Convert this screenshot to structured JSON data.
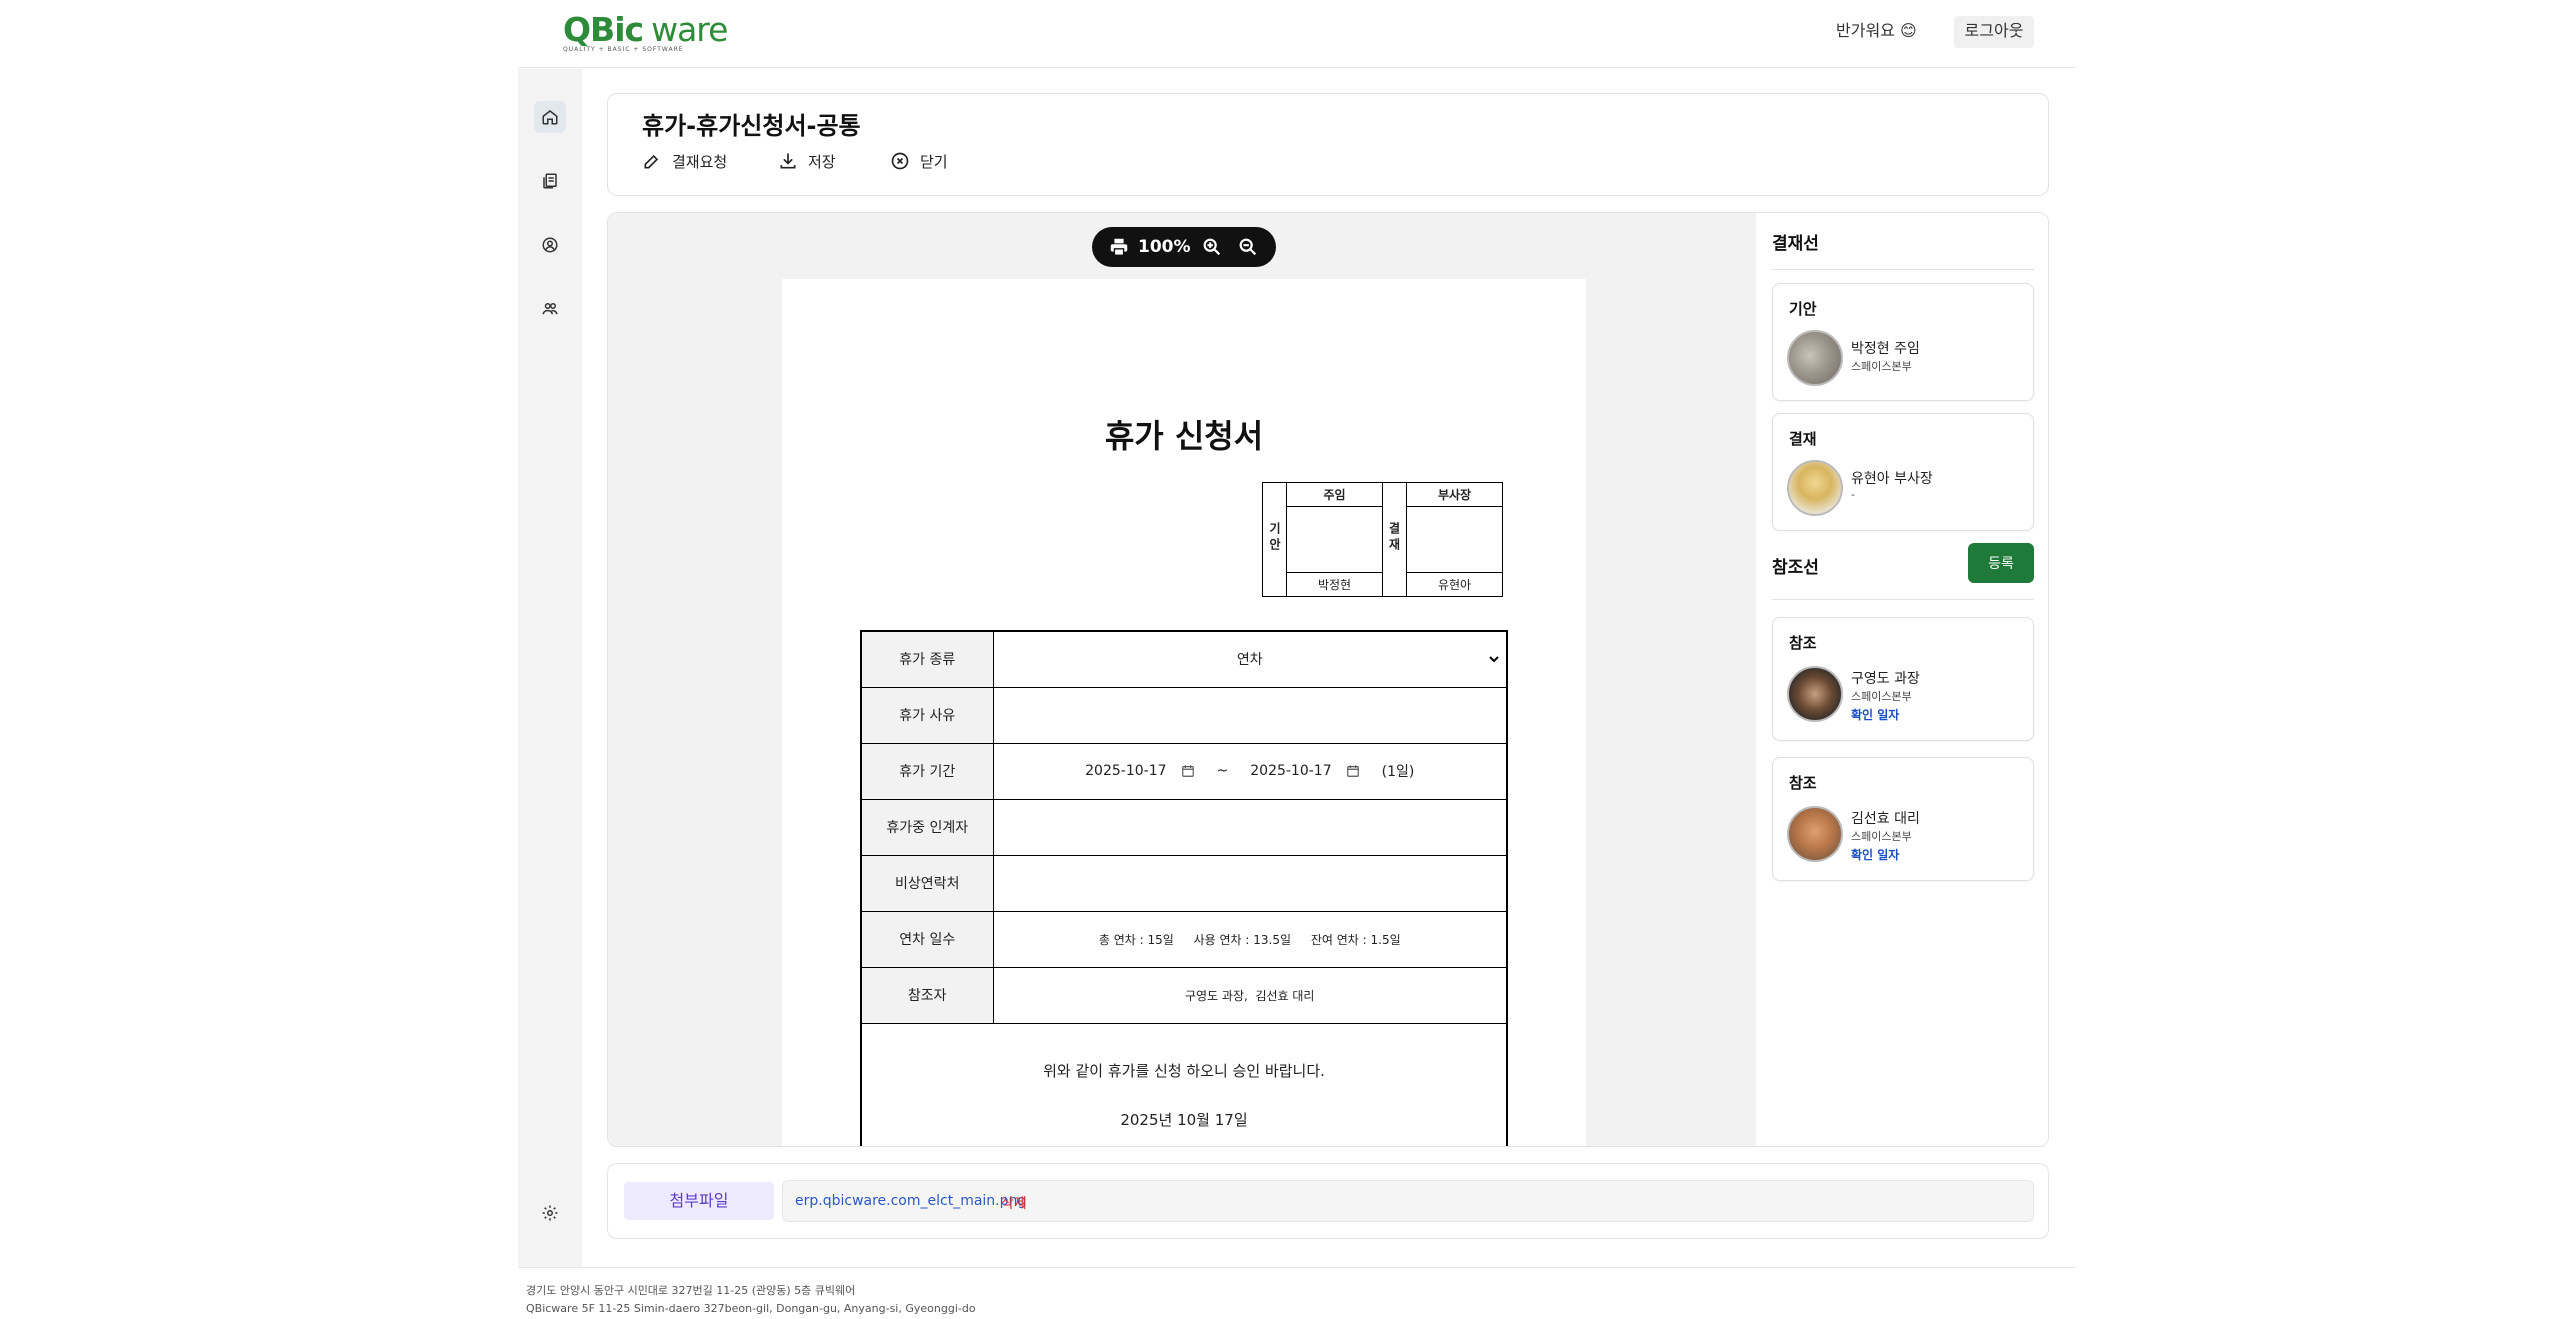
{
  "header": {
    "logo": "QBic",
    "logo_suffix": "ware",
    "logo_tagline": "QUALITY + BASIC + SOFTWARE",
    "greeting": "반가워요 😊",
    "logout_label": "로그아웃"
  },
  "sidebar": {
    "items": [
      {
        "icon": "home-icon",
        "active": true
      },
      {
        "icon": "documents-icon",
        "active": false
      },
      {
        "icon": "user-circle-icon",
        "active": false
      },
      {
        "icon": "group-icon",
        "active": false
      },
      {
        "icon": "gear-icon",
        "active": false
      }
    ]
  },
  "title_card": {
    "title": "휴가-휴가신청서-공통",
    "actions": [
      {
        "label": "결재요청",
        "icon": "edit-icon"
      },
      {
        "label": "저장",
        "icon": "download-icon"
      },
      {
        "label": "닫기",
        "icon": "close-circle-icon"
      }
    ]
  },
  "viewer": {
    "zoom": "100%"
  },
  "document": {
    "title": "휴가 신청서",
    "approval": {
      "draft_side_label": "기안",
      "approve_side_label": "결재",
      "draft_rank": "주임",
      "approve_rank": "부사장",
      "draft_name": "박정현",
      "approve_name": "유현아"
    },
    "rows": {
      "type_label": "휴가 종류",
      "type_value": "연차",
      "reason_label": "휴가 사유",
      "period_label": "휴가 기간",
      "start_date": "2025-10-17",
      "tilde": "~",
      "end_date": "2025-10-17",
      "days": "(1일)",
      "handover_label": "휴가중 인계자",
      "contact_label": "비상연락처",
      "annual_label": "연차 일수",
      "annual_total": "총 연차 : 15일",
      "annual_used": "사용 연차 : 13.5일",
      "annual_left": "잔여 연차 : 1.5일",
      "ref_label": "참조자",
      "ref_value": "구영도 과장,  김선효 대리"
    },
    "confirm_text": "위와 같이 휴가를 신청 하오니 승인 바랍니다.",
    "confirm_date": "2025년 10월 17일"
  },
  "right_panel": {
    "approval_line_title": "결재선",
    "approval_line": [
      {
        "role": "기안",
        "name": "박정현  주임",
        "dept": "스페이스본부"
      },
      {
        "role": "결재",
        "name": "유현아  부사장",
        "dept": "-"
      }
    ],
    "reference_title": "참조선",
    "register_label": "등록",
    "references": [
      {
        "role": "참조",
        "name": "구영도  과장",
        "dept": "스페이스본부",
        "check": "확인 일자"
      },
      {
        "role": "참조",
        "name": "김선효  대리",
        "dept": "스페이스본부",
        "check": "확인 일자"
      }
    ]
  },
  "attachment": {
    "label": "첨부파일",
    "file": "erp.qbicware.com_elct_main.png",
    "delete_label": "삭제"
  },
  "footer": {
    "address_ko": "경기도 안양시 동안구 시민대로 327번길 11-25 (관양동) 5층 큐빅웨어",
    "address_en": "QBicware 5F 11-25 Simin-daero 327beon-gil, Dongan-gu, Anyang-si, Gyeonggi-do"
  },
  "colors": {
    "brand": "#2e8b3a",
    "register_button": "#1f7a3a",
    "link": "#2a57c8",
    "delete": "#d9302f",
    "attach_label_bg": "#eeeaff"
  }
}
